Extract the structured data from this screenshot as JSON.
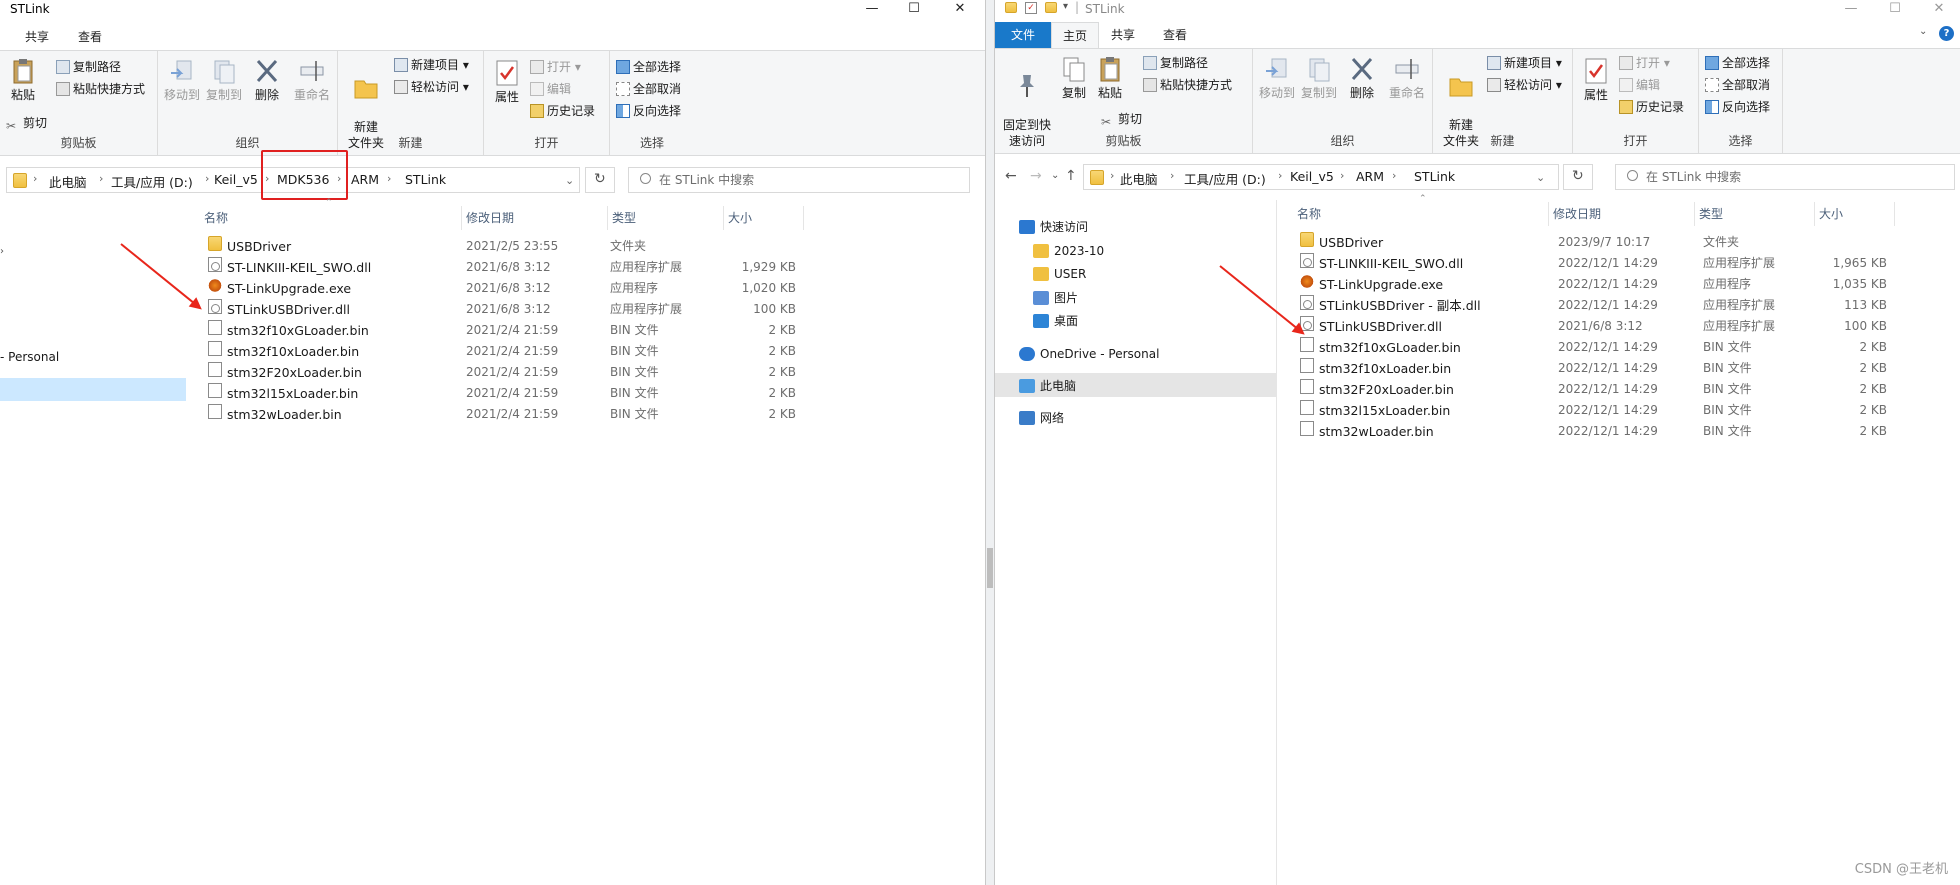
{
  "left": {
    "title": "STLink",
    "win": {
      "min": "—",
      "max": "☐",
      "close": "✕"
    },
    "tabs": [
      "共享",
      "查看"
    ],
    "ribbon": {
      "clip": {
        "paste": "粘贴",
        "copy_path": "复制路径",
        "paste_shortcut": "粘贴快捷方式",
        "cut": "剪切",
        "label": "剪贴板"
      },
      "org": {
        "move_to": "移动到",
        "copy_to": "复制到",
        "delete": "删除",
        "rename": "重命名",
        "label": "组织"
      },
      "new": {
        "new_item": "新建项目",
        "easy_access": "轻松访问",
        "new_folder": "新建\n文件夹",
        "label": "新建"
      },
      "open": {
        "properties": "属性",
        "open": "打开",
        "edit": "编辑",
        "history": "历史记录",
        "label": "打开"
      },
      "select": {
        "select_all": "全部选择",
        "select_none": "全部取消",
        "invert": "反向选择",
        "label": "选择"
      }
    },
    "breadcrumb": [
      "此电脑",
      "工具/应用 (D:)",
      "Keil_v5",
      "MDK536",
      "ARM",
      "STLink"
    ],
    "search_placeholder": "在 STLink 中搜索",
    "nav_partial": [
      "- Personal"
    ],
    "columns": {
      "name": "名称",
      "date": "修改日期",
      "type": "类型",
      "size": "大小"
    },
    "files": [
      {
        "name": "USBDriver",
        "date": "2021/2/5 23:55",
        "type": "文件夹",
        "size": "",
        "icon": "folder"
      },
      {
        "name": "ST-LINKIII-KEIL_SWO.dll",
        "date": "2021/6/8 3:12",
        "type": "应用程序扩展",
        "size": "1,929 KB",
        "icon": "dll"
      },
      {
        "name": "ST-LinkUpgrade.exe",
        "date": "2021/6/8 3:12",
        "type": "应用程序",
        "size": "1,020 KB",
        "icon": "exe"
      },
      {
        "name": "STLinkUSBDriver.dll",
        "date": "2021/6/8 3:12",
        "type": "应用程序扩展",
        "size": "100 KB",
        "icon": "dll"
      },
      {
        "name": "stm32f10xGLoader.bin",
        "date": "2021/2/4 21:59",
        "type": "BIN 文件",
        "size": "2 KB",
        "icon": "file"
      },
      {
        "name": "stm32f10xLoader.bin",
        "date": "2021/2/4 21:59",
        "type": "BIN 文件",
        "size": "2 KB",
        "icon": "file"
      },
      {
        "name": "stm32F20xLoader.bin",
        "date": "2021/2/4 21:59",
        "type": "BIN 文件",
        "size": "2 KB",
        "icon": "file"
      },
      {
        "name": "stm32l15xLoader.bin",
        "date": "2021/2/4 21:59",
        "type": "BIN 文件",
        "size": "2 KB",
        "icon": "file"
      },
      {
        "name": "stm32wLoader.bin",
        "date": "2021/2/4 21:59",
        "type": "BIN 文件",
        "size": "2 KB",
        "icon": "file"
      }
    ]
  },
  "right": {
    "title": "STLink",
    "win": {
      "min": "—",
      "max": "☐",
      "close": "✕"
    },
    "tabs": [
      "文件",
      "主页",
      "共享",
      "查看"
    ],
    "ribbon": {
      "clip": {
        "pin": "固定到快\n速访问",
        "copy": "复制",
        "paste": "粘贴",
        "copy_path": "复制路径",
        "paste_shortcut": "粘贴快捷方式",
        "cut": "剪切",
        "label": "剪贴板"
      },
      "org": {
        "move_to": "移动到",
        "copy_to": "复制到",
        "delete": "删除",
        "rename": "重命名",
        "label": "组织"
      },
      "new": {
        "new_item": "新建项目",
        "easy_access": "轻松访问",
        "new_folder": "新建\n文件夹",
        "label": "新建"
      },
      "open": {
        "properties": "属性",
        "open": "打开",
        "edit": "编辑",
        "history": "历史记录",
        "label": "打开"
      },
      "select": {
        "select_all": "全部选择",
        "select_none": "全部取消",
        "invert": "反向选择",
        "label": "选择"
      }
    },
    "breadcrumb": [
      "此电脑",
      "工具/应用 (D:)",
      "Keil_v5",
      "ARM",
      "STLink"
    ],
    "search_placeholder": "在 STLink 中搜索",
    "nav": [
      {
        "label": "快速访问",
        "icon": "star"
      },
      {
        "label": "2023-10",
        "icon": "folder"
      },
      {
        "label": "USER",
        "icon": "folder"
      },
      {
        "label": "图片",
        "icon": "picture"
      },
      {
        "label": "桌面",
        "icon": "desktop"
      },
      {
        "label": "OneDrive - Personal",
        "icon": "cloud"
      },
      {
        "label": "此电脑",
        "icon": "pc"
      },
      {
        "label": "网络",
        "icon": "network"
      }
    ],
    "columns": {
      "name": "名称",
      "date": "修改日期",
      "type": "类型",
      "size": "大小"
    },
    "files": [
      {
        "name": "USBDriver",
        "date": "2023/9/7 10:17",
        "type": "文件夹",
        "size": "",
        "icon": "folder"
      },
      {
        "name": "ST-LINKIII-KEIL_SWO.dll",
        "date": "2022/12/1 14:29",
        "type": "应用程序扩展",
        "size": "1,965 KB",
        "icon": "dll"
      },
      {
        "name": "ST-LinkUpgrade.exe",
        "date": "2022/12/1 14:29",
        "type": "应用程序",
        "size": "1,035 KB",
        "icon": "exe"
      },
      {
        "name": "STLinkUSBDriver - 副本.dll",
        "date": "2022/12/1 14:29",
        "type": "应用程序扩展",
        "size": "113 KB",
        "icon": "dll"
      },
      {
        "name": "STLinkUSBDriver.dll",
        "date": "2021/6/8 3:12",
        "type": "应用程序扩展",
        "size": "100 KB",
        "icon": "dll"
      },
      {
        "name": "stm32f10xGLoader.bin",
        "date": "2022/12/1 14:29",
        "type": "BIN 文件",
        "size": "2 KB",
        "icon": "file"
      },
      {
        "name": "stm32f10xLoader.bin",
        "date": "2022/12/1 14:29",
        "type": "BIN 文件",
        "size": "2 KB",
        "icon": "file"
      },
      {
        "name": "stm32F20xLoader.bin",
        "date": "2022/12/1 14:29",
        "type": "BIN 文件",
        "size": "2 KB",
        "icon": "file"
      },
      {
        "name": "stm32l15xLoader.bin",
        "date": "2022/12/1 14:29",
        "type": "BIN 文件",
        "size": "2 KB",
        "icon": "file"
      },
      {
        "name": "stm32wLoader.bin",
        "date": "2022/12/1 14:29",
        "type": "BIN 文件",
        "size": "2 KB",
        "icon": "file"
      }
    ]
  },
  "watermark": "CSDN @王老机",
  "colors": {
    "accent": "#1979ca",
    "selection": "#cce8ff",
    "highlight": "#e02020",
    "arrow": "#e8261b"
  }
}
